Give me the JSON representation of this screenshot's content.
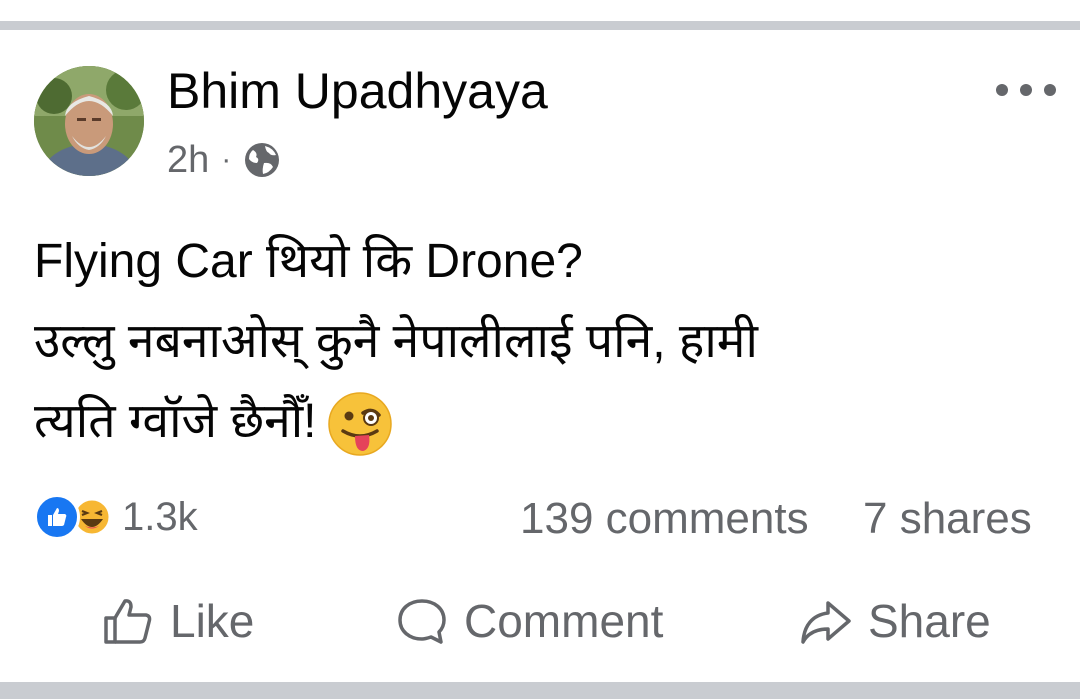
{
  "post": {
    "author": "Bhim Upadhyaya",
    "time": "2h",
    "separator": "·",
    "privacy_icon": "globe-icon",
    "text_lines": [
      "Flying Car थियो कि Drone?",
      "उल्लु नबनाओस् कुनै नेपालीलाई पनि, हामी",
      "त्यति ग्वॉजे छैनौँ!"
    ],
    "trailing_emoji": "winking-face-with-tongue"
  },
  "stats": {
    "reaction_icons": [
      "like-reaction-icon",
      "haha-reaction-icon"
    ],
    "reactions": "1.3k",
    "comments": "139 comments",
    "shares": "7 shares"
  },
  "actions": {
    "like": "Like",
    "comment": "Comment",
    "share": "Share"
  },
  "colors": {
    "text": "#050505",
    "secondary": "#65676b",
    "like_blue": "#1877f2",
    "divider": "#c9ccd1"
  }
}
